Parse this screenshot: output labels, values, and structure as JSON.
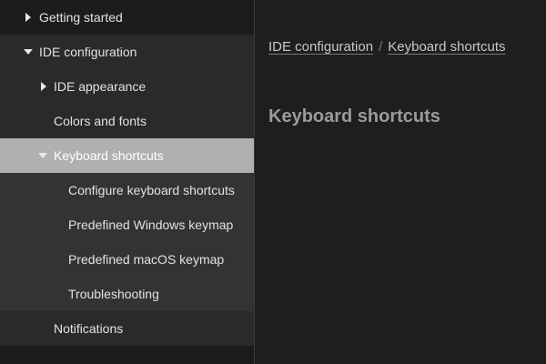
{
  "sidebar": {
    "items": [
      {
        "label": "Getting started"
      },
      {
        "label": "IDE configuration"
      },
      {
        "label": "IDE appearance"
      },
      {
        "label": "Colors and fonts"
      },
      {
        "label": "Keyboard shortcuts"
      },
      {
        "label": "Configure keyboard shortcuts"
      },
      {
        "label": "Predefined Windows keymap"
      },
      {
        "label": "Predefined macOS keymap"
      },
      {
        "label": "Troubleshooting"
      },
      {
        "label": "Notifications"
      }
    ]
  },
  "breadcrumb": {
    "items": [
      "IDE configuration",
      "Keyboard shortcuts"
    ],
    "separator": "/"
  },
  "main": {
    "title": "Keyboard shortcuts"
  },
  "colors": {
    "background": "#1e1e20",
    "sidebar_group": "#2a2a2c",
    "sidebar_subgroup": "#333335",
    "active_item": "#b0b0b0",
    "title_text": "#9b9b9b"
  },
  "icons": {
    "collapsed": "chevron-right-icon",
    "expanded": "chevron-down-icon"
  }
}
